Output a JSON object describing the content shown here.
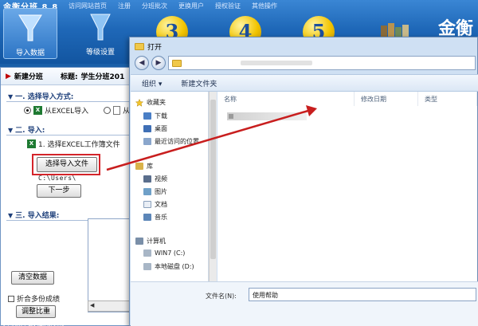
{
  "app": {
    "title": "金衡分班 8.8",
    "menu": [
      "访问网站首页",
      "注册",
      "分班批次",
      "更换用户",
      "授权验证",
      "其他操作"
    ],
    "toolbar": {
      "import_label": "导入数据",
      "grade_label": "等级设置",
      "step3": "3",
      "step4": "4",
      "step5": "5"
    },
    "brand": "金衡"
  },
  "left_panel": {
    "new_class": "新建分班",
    "title_label": "标题:",
    "title_value": "学生分班201",
    "section1": "一. 选择导入方式:",
    "radio_excel": "从EXCEL导入",
    "radio_other": "从",
    "section2": "二. 导入:",
    "step1": "1. 选择EXCEL工作簿文件",
    "choose_file_button": "选择导入文件",
    "path": "C:\\Users\\",
    "next_button": "下一步",
    "section3": "三. 导入结果:",
    "clear_button": "清空数据",
    "merge_checkbox": "折合多份成绩",
    "adjust_button": "调整比重",
    "status": "[本次双平台] 组织[对公]"
  },
  "dialog": {
    "title": "打开",
    "organize": "组织 ▾",
    "new_folder": "新建文件夹",
    "nav": {
      "favorites": "收藏夹",
      "downloads": "下载",
      "desktop": "桌面",
      "recent": "最近访问的位置",
      "libraries": "库",
      "videos": "视频",
      "pictures": "图片",
      "documents": "文档",
      "music": "音乐",
      "computer": "计算机",
      "drive_c": "WIN7 (C:)",
      "drive_d": "本地磁盘 (D:)"
    },
    "columns": [
      "名称",
      "修改日期",
      "类型"
    ],
    "filename_label": "文件名(N):",
    "filename_value": "使用帮助"
  },
  "colors": {
    "accent": "#1a5fa8",
    "highlight_box": "#d4242a"
  }
}
